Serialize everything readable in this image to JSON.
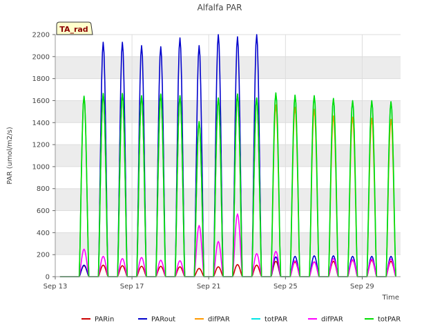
{
  "chart_data": {
    "type": "line",
    "title": "Alfalfa PAR",
    "xlabel": "Time",
    "ylabel": "PAR (umol/m2/s)",
    "badge": "TA_rad",
    "x_range_days": [
      13,
      31
    ],
    "ylim": [
      0,
      2200
    ],
    "yticks": [
      0,
      200,
      400,
      600,
      800,
      1000,
      1200,
      1400,
      1600,
      1800,
      2000,
      2200
    ],
    "xticks": [
      {
        "day": 13,
        "label": "Sep 13"
      },
      {
        "day": 17,
        "label": "Sep 17"
      },
      {
        "day": 21,
        "label": "Sep 21"
      },
      {
        "day": 25,
        "label": "Sep 25"
      },
      {
        "day": 29,
        "label": "Sep 29"
      }
    ],
    "grid": true,
    "legend_position": "bottom",
    "days": [
      13,
      14,
      15,
      16,
      17,
      18,
      19,
      20,
      21,
      22,
      23,
      24,
      25,
      26,
      27,
      28,
      29,
      30
    ],
    "series": [
      {
        "name": "PARin",
        "color": "#cc0000",
        "peaks": [
          0,
          100,
          105,
          100,
          95,
          95,
          90,
          75,
          90,
          110,
          105,
          140,
          135,
          135,
          140,
          150,
          150,
          140
        ]
      },
      {
        "name": "PARout",
        "color": "#0000cc",
        "peaks": [
          0,
          105,
          2130,
          2130,
          2100,
          2090,
          2170,
          2100,
          2200,
          2180,
          2200,
          180,
          185,
          190,
          190,
          185,
          185,
          185
        ]
      },
      {
        "name": "difPAR",
        "color": "#ff9900",
        "peaks": [
          0,
          1630,
          1660,
          1660,
          1640,
          1655,
          1640,
          1400,
          1620,
          1660,
          1620,
          1560,
          1540,
          1520,
          1460,
          1450,
          1440,
          1430
        ]
      },
      {
        "name": "totPAR",
        "color": "#00e5e5",
        "peaks": [
          0,
          1640,
          1665,
          1665,
          1645,
          1660,
          1645,
          1410,
          1625,
          1660,
          1625,
          1670,
          1650,
          1645,
          1620,
          1600,
          1600,
          1590
        ]
      },
      {
        "name": "difPAR",
        "color": "#ff00ff",
        "peaks": [
          0,
          250,
          185,
          165,
          175,
          150,
          145,
          465,
          320,
          570,
          210,
          230,
          145,
          135,
          165,
          155,
          160,
          160
        ]
      },
      {
        "name": "totPAR",
        "color": "#00dd00",
        "peaks": [
          0,
          1640,
          1665,
          1665,
          1645,
          1660,
          1645,
          1410,
          1625,
          1660,
          1625,
          1670,
          1650,
          1645,
          1620,
          1600,
          1600,
          1590
        ]
      }
    ]
  }
}
